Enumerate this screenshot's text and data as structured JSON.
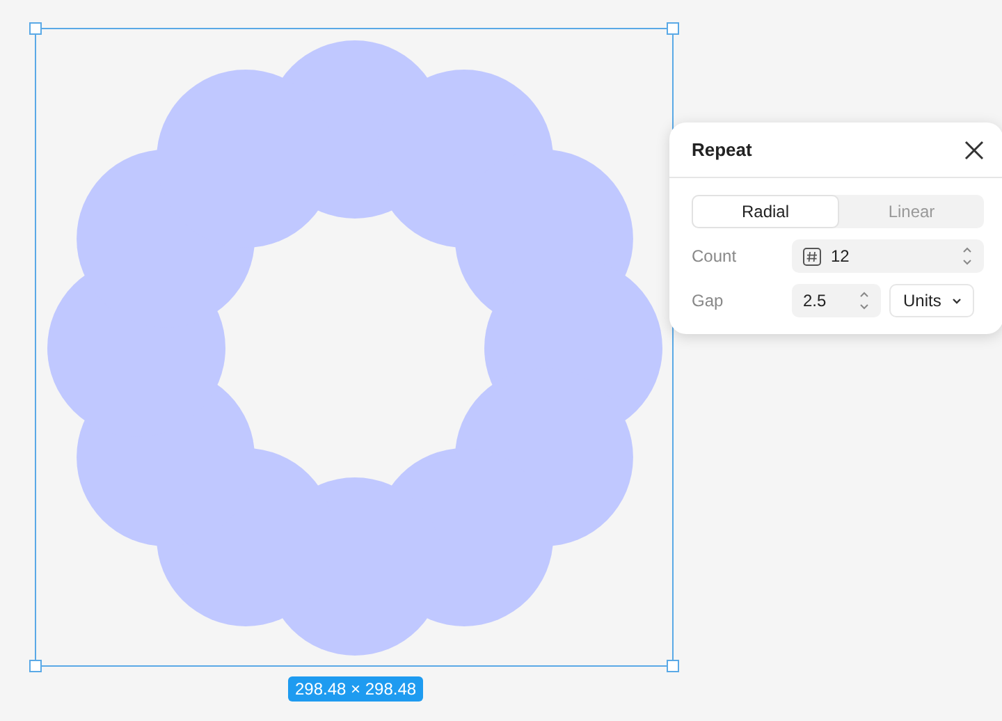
{
  "selection": {
    "size_label": "298.48 × 298.48"
  },
  "repeat_panel": {
    "title": "Repeat",
    "modes": [
      {
        "label": "Radial",
        "selected": true
      },
      {
        "label": "Linear",
        "selected": false
      }
    ],
    "count": {
      "label": "Count",
      "value": "12"
    },
    "gap": {
      "label": "Gap",
      "value": "2.5",
      "unit": "Units"
    }
  }
}
